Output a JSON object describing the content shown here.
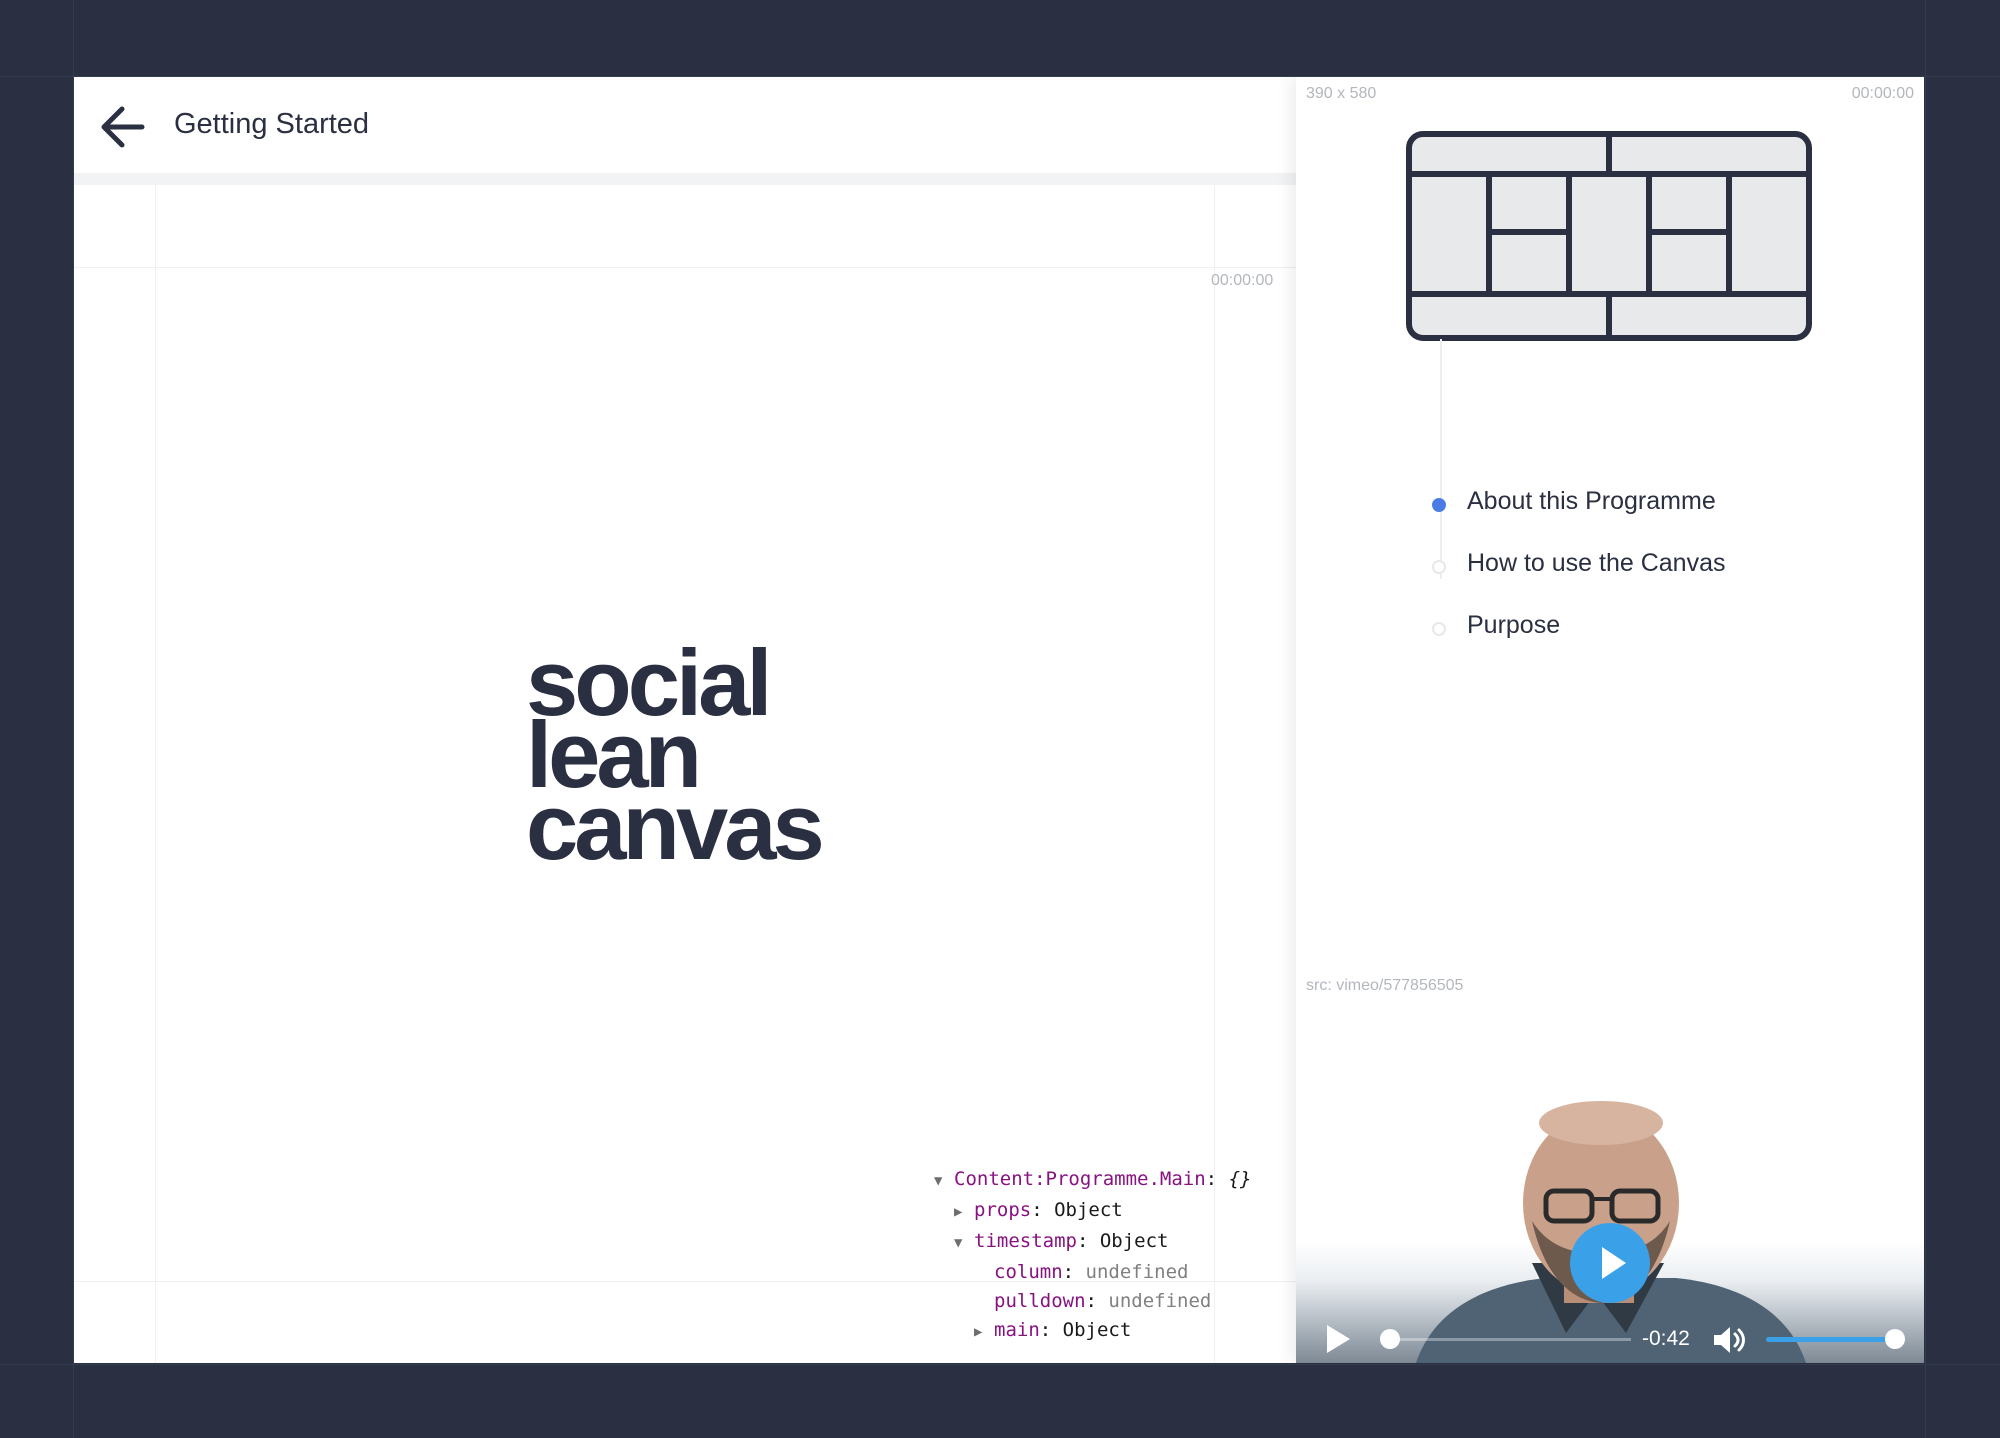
{
  "header": {
    "title": "Getting Started",
    "back_icon": "arrow-left-icon"
  },
  "stage": {
    "timecode": "00:00:00",
    "logo_lines": [
      "social",
      "lean",
      "canvas"
    ]
  },
  "devtools": {
    "root_key": "Content:Programme.Main",
    "root_value": "{}",
    "props_key": "props",
    "props_value": "Object",
    "timestamp_key": "timestamp",
    "timestamp_value": "Object",
    "column_key": "column",
    "column_value": "undefined",
    "pulldown_key": "pulldown",
    "pulldown_value": "undefined",
    "main_key": "main",
    "main_value": "Object"
  },
  "panel": {
    "size_label": "390 x 580",
    "timecode": "00:00:00",
    "toc": [
      {
        "label": "About this Programme",
        "active": true
      },
      {
        "label": "How to use the Canvas",
        "active": false
      },
      {
        "label": "Purpose",
        "active": false
      }
    ],
    "src_label": "src: vimeo/577856505"
  },
  "video": {
    "remaining": "-0:42",
    "progress": 0,
    "volume": 1.0,
    "accent_color": "#3aa0e8"
  }
}
